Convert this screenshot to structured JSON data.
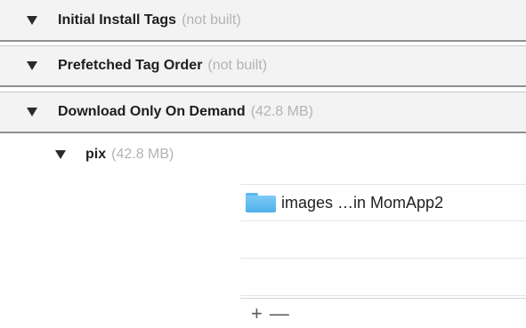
{
  "sections": [
    {
      "title": "Initial Install Tags",
      "status": "(not built)"
    },
    {
      "title": "Prefetched Tag Order",
      "status": "(not built)"
    },
    {
      "title": "Download Only On Demand",
      "status": "(42.8 MB)"
    }
  ],
  "tag": {
    "name": "pix",
    "size": "(42.8 MB)"
  },
  "resources": [
    {
      "label": "images  …in MomApp2",
      "icon": "folder-icon"
    }
  ],
  "toolbar": {
    "add_label": "+",
    "remove_label": "—"
  },
  "colors": {
    "folder": "#5ab8ef",
    "muted_text": "#b3b3b3",
    "header_bg": "#f3f3f3"
  }
}
